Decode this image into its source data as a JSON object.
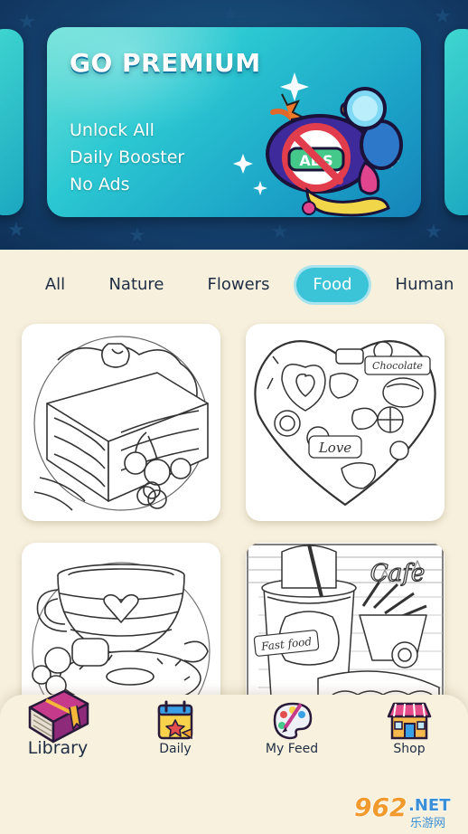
{
  "promo": {
    "title": "GO PREMIUM",
    "features": [
      "Unlock All",
      "Daily Booster",
      "No Ads"
    ],
    "badge_text": "ADS",
    "icon": "no-ads-bomb-icon"
  },
  "categories": {
    "items": [
      "All",
      "Nature",
      "Flowers",
      "Food",
      "Human"
    ],
    "selected": "Food"
  },
  "cards": [
    {
      "icon": "cake-slice-coloring-page",
      "text": ""
    },
    {
      "icon": "sweets-heart-coloring-page",
      "text_1": "Chocolate",
      "text_2": "Love"
    },
    {
      "icon": "coffee-cup-donut-coloring-page",
      "text": ""
    },
    {
      "icon": "fast-food-coloring-page",
      "text_1": "Cafe",
      "text_2": "Fast food"
    }
  ],
  "nav": {
    "items": [
      {
        "label": "Library",
        "icon": "book-icon",
        "active": true
      },
      {
        "label": "Daily",
        "icon": "calendar-icon",
        "active": false
      },
      {
        "label": "My Feed",
        "icon": "palette-icon",
        "active": false
      },
      {
        "label": "Shop",
        "icon": "shop-icon",
        "active": false
      }
    ]
  },
  "watermark": {
    "text_1": "962",
    "text_2": ".NET",
    "text_3": "乐游网"
  },
  "colors": {
    "banner_bg": "#143f6b",
    "promo_card": "#2bc8d2",
    "tab_active": "#3bc3d8",
    "page_bg": "#f7f0dd",
    "text_dark": "#1f2d45"
  }
}
